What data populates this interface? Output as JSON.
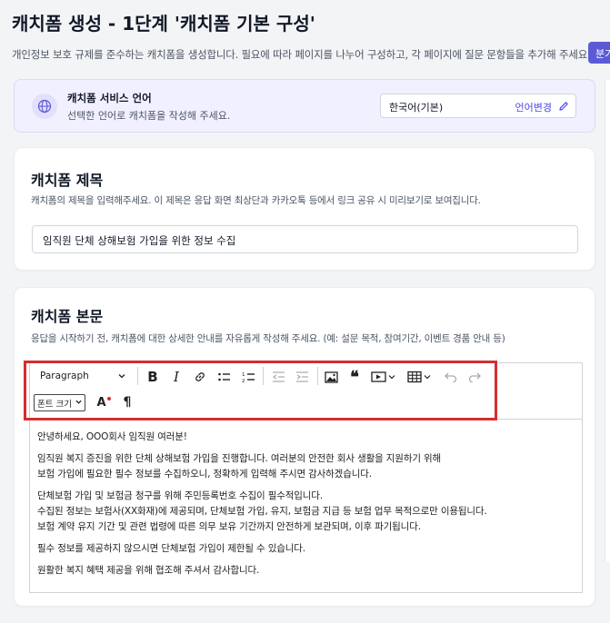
{
  "header": {
    "title": "캐치폼 생성 - 1단계 '캐치폼 기본 구성'",
    "description": "개인정보 보호 규제를 준수하는 캐치폼을 생성합니다. 필요에 따라 페이지를 나누어 구성하고, 각 페이지에 질문 문항들을 추가해 주세요.",
    "corner_button_label": "분기"
  },
  "language": {
    "title": "캐치폼 서비스 언어",
    "subtitle": "선택한 언어로 캐치폼을 작성해 주세요.",
    "current_value": "한국어(기본)",
    "change_label": "언어변경",
    "icon": "globe-icon"
  },
  "form_title": {
    "heading": "캐치폼 제목",
    "description": "캐치폼의 제목을 입력해주세요. 이 제목은 응답 화면 최상단과 카카오톡 등에서 링크 공유 시 미리보기로 보여집니다.",
    "value": "임직원 단체 상해보험 가입을 위한 정보 수집"
  },
  "form_body": {
    "heading": "캐치폼 본문",
    "description": "응답을 시작하기 전, 캐치폼에 대한 상세한 안내를 자유롭게 작성해 주세요. (예: 설문 목적, 참여기간, 이벤트 경품 안내 등)",
    "toolbar": {
      "paragraph_value": "Paragraph",
      "font_size_value": "폰트 크기",
      "icons": [
        "bold-icon",
        "italic-icon",
        "link-icon",
        "bulleted-list-icon",
        "numbered-list-icon",
        "outdent-icon",
        "indent-icon",
        "image-icon",
        "blockquote-icon",
        "media-embed-icon",
        "table-icon",
        "undo-icon",
        "redo-icon",
        "font-color-icon",
        "paragraph-mark-icon"
      ]
    },
    "content": [
      "안녕하세요, OOO회사 임직원 여러분!",
      "임직원 복지 증진을 위한 단체 상해보험 가입을 진행합니다. 여러분의 안전한 회사 생활을 지원하기 위해",
      "보험 가입에 필요한 필수 정보를 수집하오니, 정확하게 입력해 주시면 감사하겠습니다.",
      "단체보험 가입 및 보험금 청구를 위해 주민등록번호 수집이 필수적입니다.",
      "수집된 정보는 보험사(XX화재)에 제공되며, 단체보험 가입, 유지, 보험금 지급 등 보험 업무 목적으로만 이용됩니다.",
      "보험 계약 유지 기간 및 관련 법령에 따른 의무 보유 기간까지 안전하게 보관되며, 이후 파기됩니다.",
      "필수 정보를 제공하지 않으시면 단체보험 가입이 제한될 수 있습니다.",
      "원활한 복지 혜택 제공을 위해 협조해 주셔서 감사합니다."
    ]
  },
  "colors": {
    "accent": "#4f46e5",
    "language_box_bg": "#f1f0ff",
    "highlight": "#d32f2f"
  }
}
